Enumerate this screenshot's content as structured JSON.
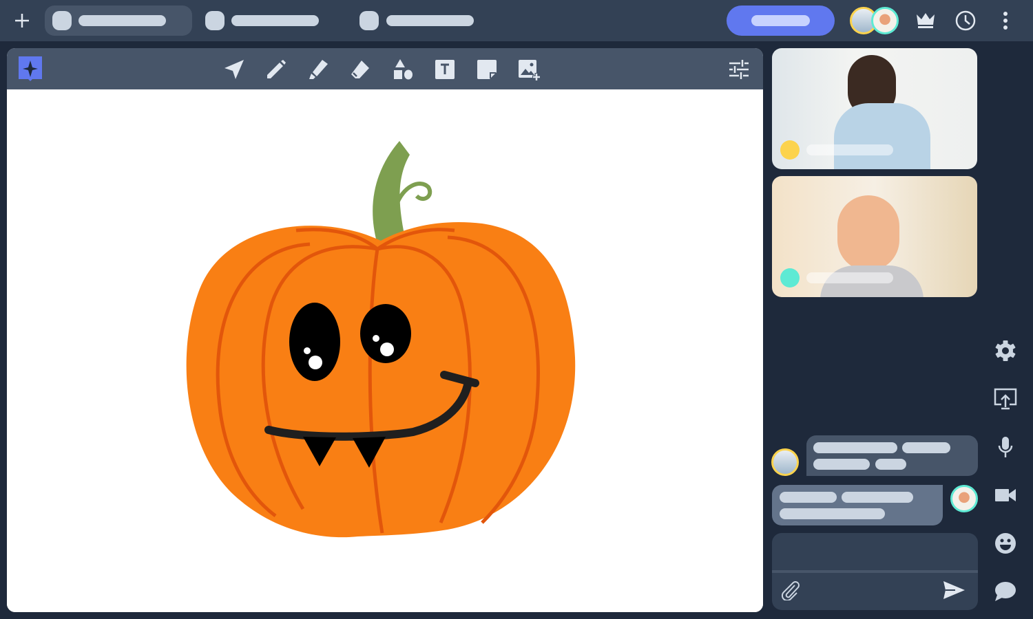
{
  "colors": {
    "topbar": "#334155",
    "background": "#1e293b",
    "toolbar": "#475569",
    "accent": "#6078ef",
    "placeholder": "#cbd5e1",
    "user1_ring": "#fcd34d",
    "user2_ring": "#5eead4",
    "pumpkin": "#f97f14",
    "pumpkin_rib": "#e2560b",
    "stem": "#7e9f50"
  },
  "topbar": {
    "icons": [
      "plus-icon",
      "crown-icon",
      "clock-icon",
      "more-vertical-icon"
    ],
    "tabs": 3
  },
  "toolbar": {
    "tools": [
      "select-arrow",
      "pencil",
      "marker",
      "eraser",
      "shapes",
      "text",
      "sticky-note",
      "add-image"
    ],
    "settings_icon": "sliders-icon"
  },
  "participants": [
    {
      "name": "participant-1",
      "ring": "#fcd34d"
    },
    {
      "name": "participant-2",
      "ring": "#5eead4"
    }
  ],
  "side_actions": [
    "settings",
    "screen-share",
    "microphone",
    "camera",
    "emoji",
    "chat"
  ]
}
